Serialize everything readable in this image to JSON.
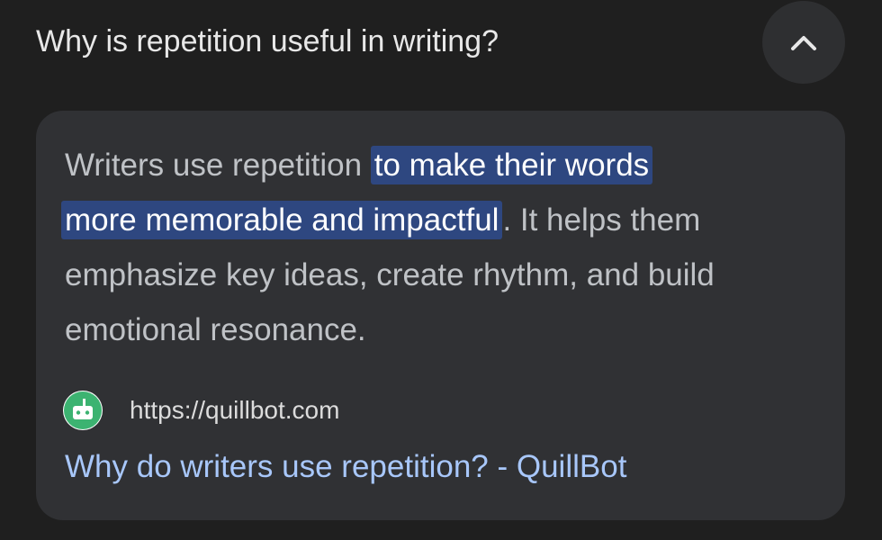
{
  "question": {
    "title": "Why is repetition useful in writing?",
    "toggle_icon": "chevron-up-icon"
  },
  "answer": {
    "text_before": "Writers use repetition ",
    "highlight_line1": "to make their words",
    "highlight_line2": "more memorable and impactful",
    "text_after": ". It helps them emphasize key ideas, create rhythm, and build emotional resonance.",
    "highlight_color": "#2e4780"
  },
  "source": {
    "favicon_icon": "quillbot-logo-icon",
    "favicon_color": "#3cb371",
    "url": "https://quillbot.com",
    "link_text": "Why do writers use repetition? - QuillBot",
    "link_color": "#a8c7fa"
  }
}
